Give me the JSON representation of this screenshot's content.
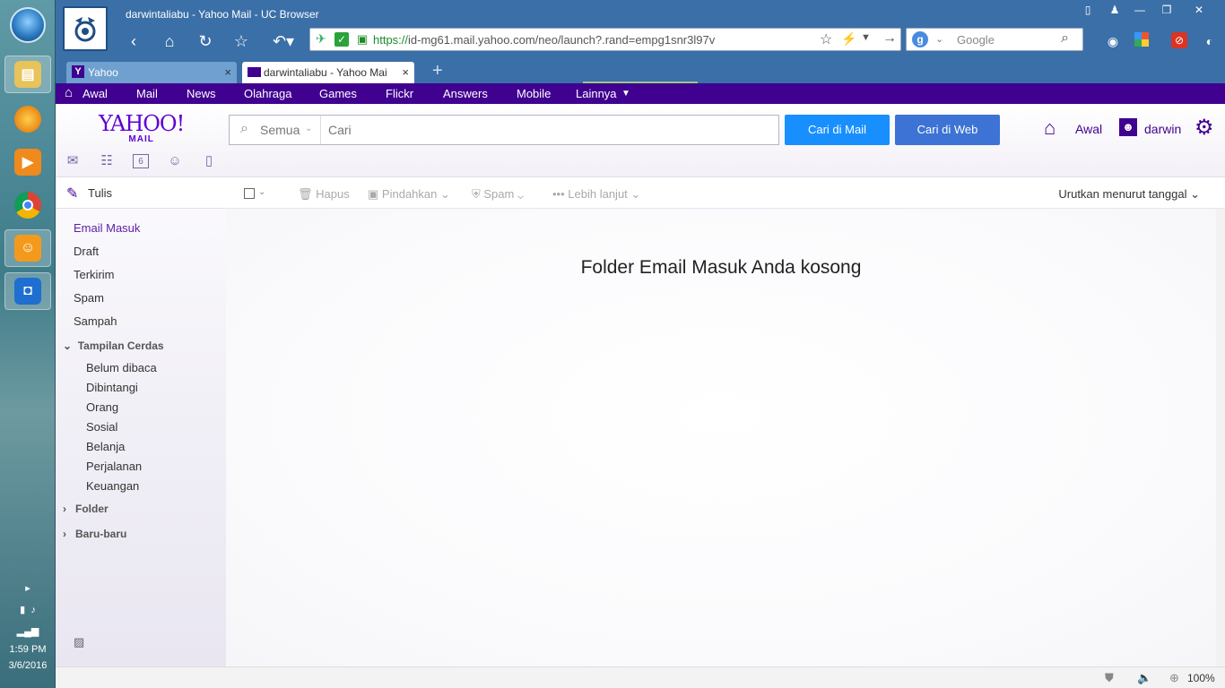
{
  "taskbar": {
    "time": "1:59 PM",
    "date": "3/6/2016"
  },
  "window": {
    "title": "darwintaliabu - Yahoo Mail - UC Browser"
  },
  "browser": {
    "url_scheme": "https://",
    "url_rest": "id-mg61.mail.yahoo.com/neo/launch?.rand=empg1snr3l97v",
    "search_placeholder": "Google",
    "zoom": "100%",
    "tabs": [
      {
        "label": "Yahoo",
        "close": "×"
      },
      {
        "label": "darwintaliabu - Yahoo Mai",
        "close": "×"
      }
    ],
    "new_tab": "+"
  },
  "yahoo_nav": {
    "items": [
      "Awal",
      "Mail",
      "News",
      "Olahraga",
      "Games",
      "Flickr",
      "Answers",
      "Mobile",
      "Lainnya"
    ]
  },
  "header": {
    "logo_big": "YAHOO!",
    "logo_small": "MAIL",
    "scope": "Semua",
    "search_placeholder": "Cari",
    "search_mail_btn": "Cari di Mail",
    "search_web_btn": "Cari di Web",
    "home_link": "Awal",
    "user_link": "darwin",
    "accent": "#400090",
    "button_color": "#188fff"
  },
  "compose": {
    "label": "Tulis"
  },
  "toolbar": {
    "delete": "Hapus",
    "move": "Pindahkan",
    "spam": "Spam",
    "more": "Lebih lanjut",
    "sort": "Urutkan menurut tanggal"
  },
  "folders": [
    "Email Masuk",
    "Draft",
    "Terkirim",
    "Spam",
    "Sampah"
  ],
  "smart_views": {
    "title": "Tampilan Cerdas",
    "items": [
      "Belum dibaca",
      "Dibintangi",
      "Orang",
      "Sosial",
      "Belanja",
      "Perjalanan",
      "Keuangan"
    ]
  },
  "groups": {
    "folder": "Folder",
    "recent": "Baru-baru"
  },
  "main": {
    "empty_message": "Folder Email Masuk Anda kosong"
  }
}
